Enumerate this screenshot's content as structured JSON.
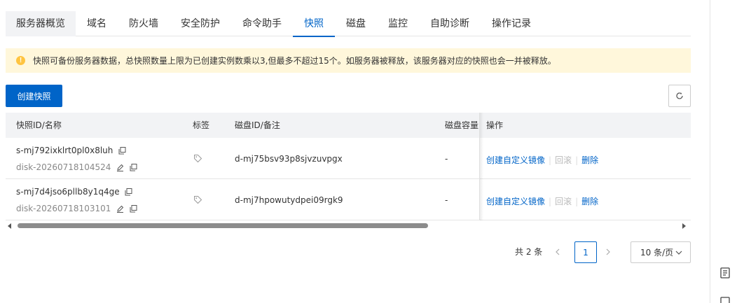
{
  "tabs": [
    {
      "label": "服务器概览"
    },
    {
      "label": "域名"
    },
    {
      "label": "防火墙"
    },
    {
      "label": "安全防护"
    },
    {
      "label": "命令助手"
    },
    {
      "label": "快照"
    },
    {
      "label": "磁盘"
    },
    {
      "label": "监控"
    },
    {
      "label": "自助诊断"
    },
    {
      "label": "操作记录"
    }
  ],
  "active_tab": "快照",
  "notice": {
    "icon": "warning-icon",
    "text": "快照可备份服务器数据，总快照数量上限为已创建实例数乘以3,但最多不超过15个。如服务器被释放，该服务器对应的快照也会一并被释放。"
  },
  "toolbar": {
    "create_label": "创建快照",
    "refresh_icon": "refresh-icon"
  },
  "table": {
    "headers": {
      "id": "快照ID/名称",
      "tags": "标签",
      "disk": "磁盘ID/备注",
      "size": "磁盘容量",
      "ops": "操作"
    },
    "rows": [
      {
        "snapshot_id": "s-mj792ixklrt0pl0x8luh",
        "name": "disk-20260718104524",
        "disk_id": "d-mj75bsv93p8sjvzuvpgx",
        "size": "-",
        "actions": {
          "create_image": "创建自定义镜像",
          "rollback": "回滚",
          "delete": "删除"
        }
      },
      {
        "snapshot_id": "s-mj7d4jso6pllb8y1q4ge",
        "name": "disk-20260718103101",
        "disk_id": "d-mj7hpowutydpei09rgk9",
        "size": "-",
        "actions": {
          "create_image": "创建自定义镜像",
          "rollback": "回滚",
          "delete": "删除"
        }
      }
    ]
  },
  "pagination": {
    "total": "共 2 条",
    "current_page": "1",
    "page_size": "10 条/页"
  },
  "colors": {
    "primary": "#0064c8",
    "notice_bg": "#fff7db",
    "warning": "#ffc440",
    "header_bg": "#f2f3f5"
  }
}
